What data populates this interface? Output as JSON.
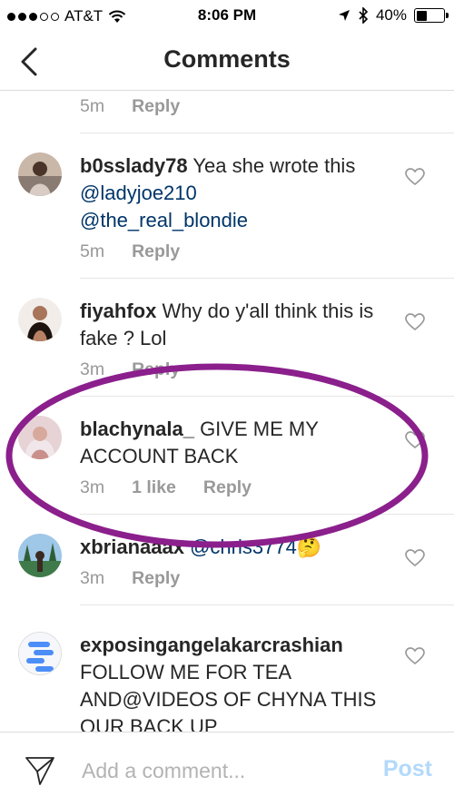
{
  "status": {
    "carrier": "AT&T",
    "time": "8:06 PM",
    "battery": "40%"
  },
  "header": {
    "title": "Comments"
  },
  "comments": [
    {
      "username": "",
      "text": "",
      "time": "5m",
      "likes": "",
      "reply": "Reply"
    },
    {
      "username": "b0sslady78",
      "text": " Yea she wrote this ",
      "mention1": "@ladyjoe210",
      "mention2": "@the_real_blondie",
      "time": "5m",
      "reply": "Reply"
    },
    {
      "username": "fiyahfox",
      "text": " Why do y'all think this is fake ? Lol",
      "time": "3m",
      "reply": "Reply"
    },
    {
      "username": "blachynala_",
      "text": " GIVE ME MY ACCOUNT BACK",
      "time": "3m",
      "likes": "1 like",
      "reply": "Reply"
    },
    {
      "username": "xbrianaaax",
      "text": " ",
      "mention1": "@chris3774",
      "emoji": "🤔",
      "time": "3m",
      "reply": "Reply"
    },
    {
      "username": "exposingangelakarcrashian",
      "text": "FOLLOW ME FOR TEA AND@VIDEOS OF CHYNA THIS OUR BACK UP"
    }
  ],
  "composer": {
    "placeholder": "Add a comment...",
    "post_label": "Post"
  },
  "colors": {
    "mention": "#003569",
    "annotation": "#8b1f8c",
    "post_disabled": "#b3d9fb"
  }
}
